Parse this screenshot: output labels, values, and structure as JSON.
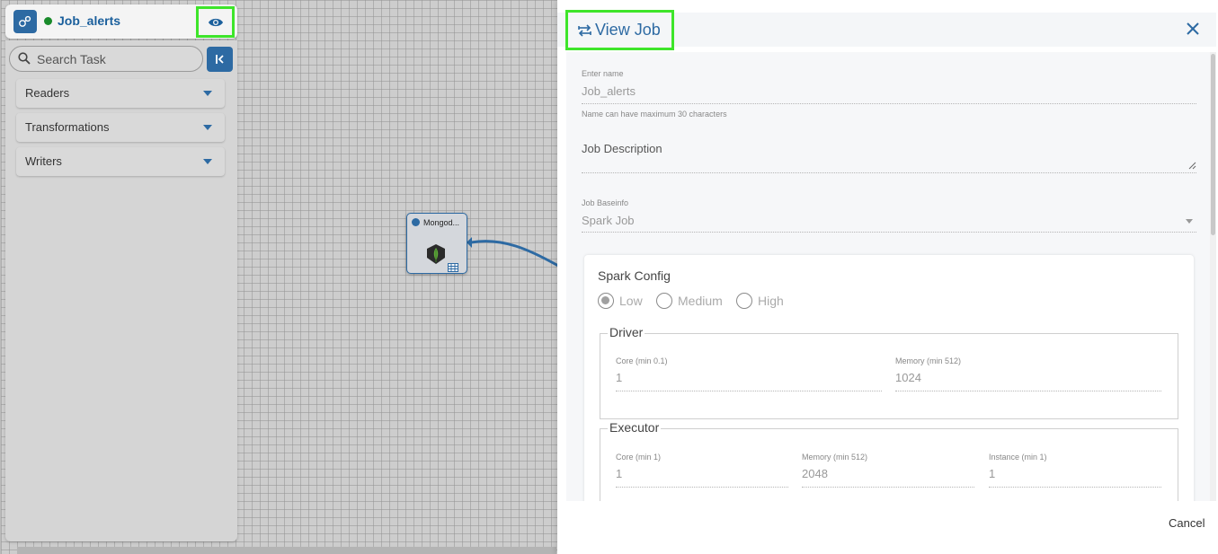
{
  "job": {
    "title": "Job_alerts",
    "status_color": "#198a2a"
  },
  "sidebar": {
    "search_placeholder": "Search Task",
    "categories": [
      {
        "label": "Readers"
      },
      {
        "label": "Transformations"
      },
      {
        "label": "Writers"
      }
    ]
  },
  "node": {
    "label": "Mongod...",
    "icon": "mongodb-leaf-icon"
  },
  "panel": {
    "title": "View Job",
    "title_icon": "swap-arrows-icon",
    "close_icon": "close-icon",
    "name": {
      "label": "Enter name",
      "value": "Job_alerts",
      "hint": "Name can have maximum 30 characters"
    },
    "description": {
      "label": "Job Description"
    },
    "baseinfo": {
      "label": "Job Baseinfo",
      "value": "Spark Job"
    },
    "spark_config": {
      "title": "Spark Config",
      "options": [
        {
          "label": "Low",
          "selected": true
        },
        {
          "label": "Medium",
          "selected": false
        },
        {
          "label": "High",
          "selected": false
        }
      ],
      "driver": {
        "legend": "Driver",
        "core_label": "Core (min 0.1)",
        "core_value": "1",
        "memory_label": "Memory (min 512)",
        "memory_value": "1024"
      },
      "executor": {
        "legend": "Executor",
        "core_label": "Core (min 1)",
        "core_value": "1",
        "memory_label": "Memory (min 512)",
        "memory_value": "2048",
        "instance_label": "Instance (min 1)",
        "instance_value": "1"
      }
    },
    "cancel_label": "Cancel"
  },
  "colors": {
    "accent": "#2d6aa3",
    "highlight": "#3ee52a"
  }
}
